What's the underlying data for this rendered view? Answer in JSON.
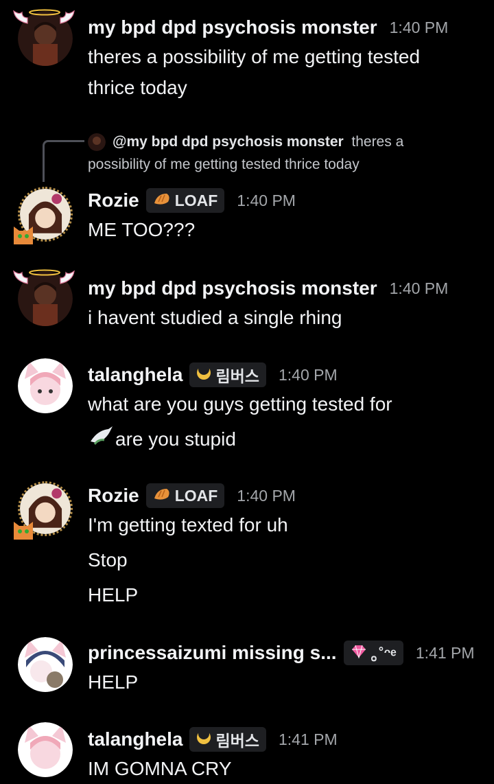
{
  "messages": [
    {
      "username": "my bpd dpd psychosis monster",
      "time": "1:40 PM",
      "lines": [
        "theres a possibility of me getting tested",
        "thrice today"
      ]
    },
    {
      "reply": {
        "mention": "@my bpd dpd psychosis monster",
        "text": "theres a possibility of me getting tested thrice today"
      },
      "username": "Rozie",
      "tag": {
        "label": "LOAF",
        "icon": "croissant-icon"
      },
      "time": "1:40 PM",
      "lines": [
        "ME TOO???"
      ]
    },
    {
      "username": "my bpd dpd psychosis monster",
      "time": "1:40 PM",
      "lines": [
        "i havent studied a single rhing"
      ]
    },
    {
      "username": "talanghela",
      "tag": {
        "label": "림버스",
        "icon": "crescent-moon-icon"
      },
      "time": "1:40 PM",
      "lines": [
        "what are you guys getting tested for",
        "are you stupid"
      ]
    },
    {
      "username": "Rozie",
      "tag": {
        "label": "LOAF",
        "icon": "croissant-icon"
      },
      "time": "1:40 PM",
      "lines": [
        "I'm getting texted for uh",
        "Stop",
        "HELP"
      ]
    },
    {
      "username": "princessaizumi missing s...",
      "tag": {
        "label": "｡˚ᵔᵉ",
        "icon": "pink-gem-icon"
      },
      "time": "1:41 PM",
      "lines": [
        "HELP"
      ]
    },
    {
      "username": "talanghela",
      "tag": {
        "label": "림버스",
        "icon": "crescent-moon-icon"
      },
      "time": "1:41 PM",
      "lines": [
        "IM GOMNA CRY"
      ]
    }
  ],
  "colors": {
    "background": "#000000",
    "text": "#f2f3f5",
    "timestamp": "#a3a6aa",
    "tag_bg": "#1e1f22",
    "gold": "#f0c040"
  }
}
